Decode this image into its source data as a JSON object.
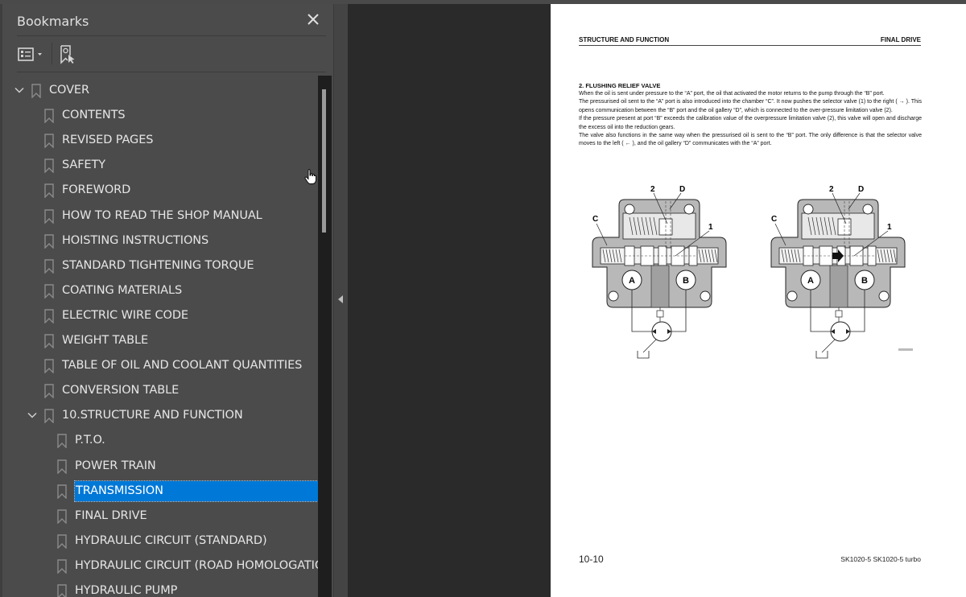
{
  "app": {
    "panel": {
      "title": "Bookmarks",
      "close_icon": "close-icon",
      "toolbar": {
        "options_icon": "list-options-icon",
        "find_bookmark_icon": "bookmark-target-icon"
      }
    },
    "bookmarks": [
      {
        "label": "COVER",
        "level": 0,
        "expanded": true,
        "has_children": true
      },
      {
        "label": "CONTENTS",
        "level": 1
      },
      {
        "label": "REVISED PAGES",
        "level": 1
      },
      {
        "label": "SAFETY",
        "level": 1
      },
      {
        "label": "FOREWORD",
        "level": 1
      },
      {
        "label": "HOW TO READ THE SHOP MANUAL",
        "level": 1
      },
      {
        "label": "HOISTING INSTRUCTIONS",
        "level": 1
      },
      {
        "label": "STANDARD TIGHTENING TORQUE",
        "level": 1
      },
      {
        "label": "COATING MATERIALS",
        "level": 1
      },
      {
        "label": "ELECTRIC WIRE CODE",
        "level": 1
      },
      {
        "label": "WEIGHT TABLE",
        "level": 1
      },
      {
        "label": "TABLE OF OIL AND COOLANT QUANTITIES",
        "level": 1
      },
      {
        "label": "CONVERSION TABLE",
        "level": 1
      },
      {
        "label": "10.STRUCTURE AND FUNCTION",
        "level": 1,
        "expanded": true,
        "has_children": true
      },
      {
        "label": "P.T.O.",
        "level": 2
      },
      {
        "label": "POWER TRAIN",
        "level": 2
      },
      {
        "label": "TRANSMISSION",
        "level": 2,
        "selected": true
      },
      {
        "label": "FINAL DRIVE",
        "level": 2
      },
      {
        "label": "HYDRAULIC CIRCUIT (STANDARD)",
        "level": 2
      },
      {
        "label": "HYDRAULIC CIRCUIT (ROAD HOMOLOGATION)",
        "level": 2
      },
      {
        "label": "HYDRAULIC PUMP",
        "level": 2
      }
    ],
    "colors": {
      "selection": "#0078d7",
      "panel_bg": "#4b4b4b",
      "viewer_bg": "#2a2a2a"
    }
  },
  "document": {
    "header_left": "STRUCTURE AND FUNCTION",
    "header_right": "FINAL DRIVE",
    "section_title": "2.   FLUSHING RELIEF VALVE",
    "paragraphs": [
      "When the oil is sent under pressure to the “A” port, the oil that activated the motor returns to the pump through the “B” port.",
      "The pressurised oil sent to the “A” port is also introduced into the chamber “C”.  It now pushes the selector valve (1) to the right ( → ). This opens communication between the “B” port and the oil gallery “D”, which is connected to the over-pressure limitation valve (2).",
      "If the pressure present at port “B” exceeds the calibration value of the overpressure limitation valve (2), this valve will open and discharge the excess oil into the reduction gears.",
      "The valve also functions in the same way when the pressurised oil is sent to the “B” port.  The only difference is that the selector valve moves to the left ( ← ), and the oil gallery “D” communicates with the “A” port."
    ],
    "diagram_labels": {
      "two": "2",
      "d": "D",
      "c": "C",
      "one": "1",
      "a": "A",
      "b": "B"
    },
    "page_number": "10-10",
    "model": "SK1020-5  SK1020-5 turbo"
  }
}
